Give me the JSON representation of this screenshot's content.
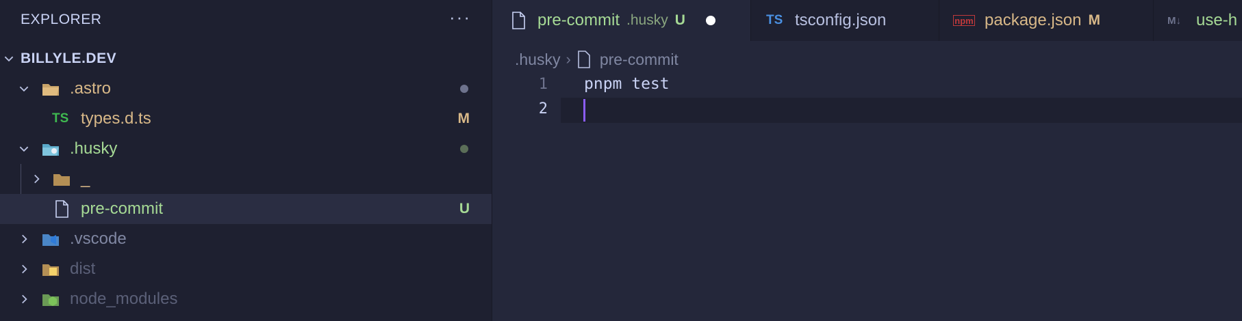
{
  "explorer": {
    "title": "EXPLORER",
    "more": "···",
    "root": "BILLYLE.DEV",
    "tree": [
      {
        "name": ".astro",
        "status": "dot"
      },
      {
        "name": "types.d.ts",
        "icon_text": "TS",
        "badge": "M"
      },
      {
        "name": ".husky",
        "status": "dot"
      },
      {
        "name": "_"
      },
      {
        "name": "pre-commit",
        "badge": "U"
      },
      {
        "name": ".vscode"
      },
      {
        "name": "dist"
      },
      {
        "name": "node_modules"
      }
    ]
  },
  "tabs": [
    {
      "name": "pre-commit",
      "description": ".husky",
      "badge": "U",
      "dirty": true
    },
    {
      "name": "tsconfig.json",
      "icon_text": "TS"
    },
    {
      "name": "package.json",
      "badge": "M",
      "icon_text": "npm"
    },
    {
      "name": "use-h",
      "icon_text": "M↓"
    }
  ],
  "breadcrumb": {
    "folder": ".husky",
    "separator": "›",
    "file": "pre-commit"
  },
  "editor": {
    "lines": [
      {
        "number": "1",
        "text": "pnpm test"
      },
      {
        "number": "2",
        "text": ""
      }
    ]
  },
  "colors": {
    "accent": "#8b5cf6",
    "modified": "#d8b888",
    "untracked": "#a6da95",
    "text": "#cad3f5",
    "muted": "#6e738d"
  },
  "icons": [
    "chevron-down-icon",
    "chevron-right-icon",
    "folder-icon",
    "file-icon",
    "more-icon"
  ]
}
